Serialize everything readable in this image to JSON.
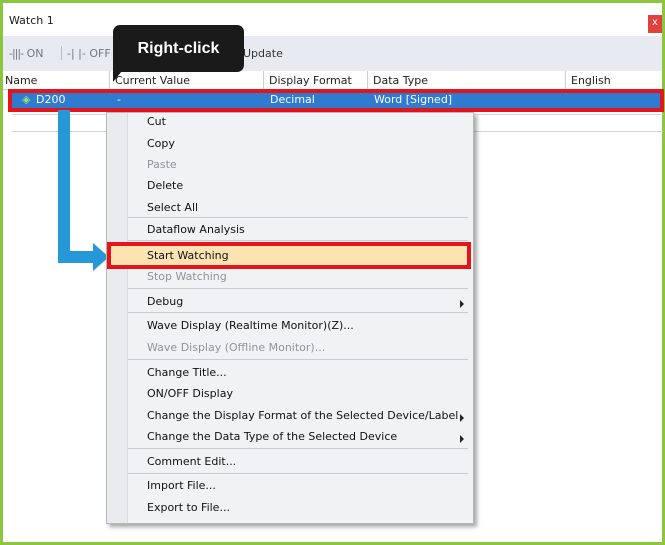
{
  "window": {
    "title": "Watch 1",
    "close": "x"
  },
  "toolbar": {
    "on": "ON",
    "off": "OFF",
    "update": "Update"
  },
  "columns": {
    "name": "Name",
    "current_value": "Current Value",
    "display_format": "Display Format",
    "data_type": "Data Type",
    "english": "English"
  },
  "row": {
    "name": "D200",
    "current_value": "-",
    "display_format": "Decimal",
    "data_type": "Word [Signed]"
  },
  "callout": {
    "label": "Right-click"
  },
  "menu": {
    "cut": "Cut",
    "copy": "Copy",
    "paste": "Paste",
    "delete": "Delete",
    "select_all": "Select All",
    "dataflow_analysis": "Dataflow Analysis",
    "start_watching": "Start Watching",
    "stop_watching": "Stop Watching",
    "debug": "Debug",
    "wave_realtime": "Wave Display (Realtime Monitor)(Z)...",
    "wave_offline": "Wave Display (Offline Monitor)...",
    "change_title": "Change Title...",
    "onoff_display": "ON/OFF Display",
    "change_display_format": "Change the Display Format of the Selected Device/Label",
    "change_data_type": "Change the Data Type of the Selected Device",
    "comment_edit": "Comment Edit...",
    "import_file": "Import File...",
    "export_file": "Export to File..."
  },
  "colors": {
    "frame": "#8cc63f",
    "selection": "#2e7bd0",
    "highlight": "#e3141b",
    "arrow": "#2698d8",
    "hover": "#fbe3b2"
  }
}
